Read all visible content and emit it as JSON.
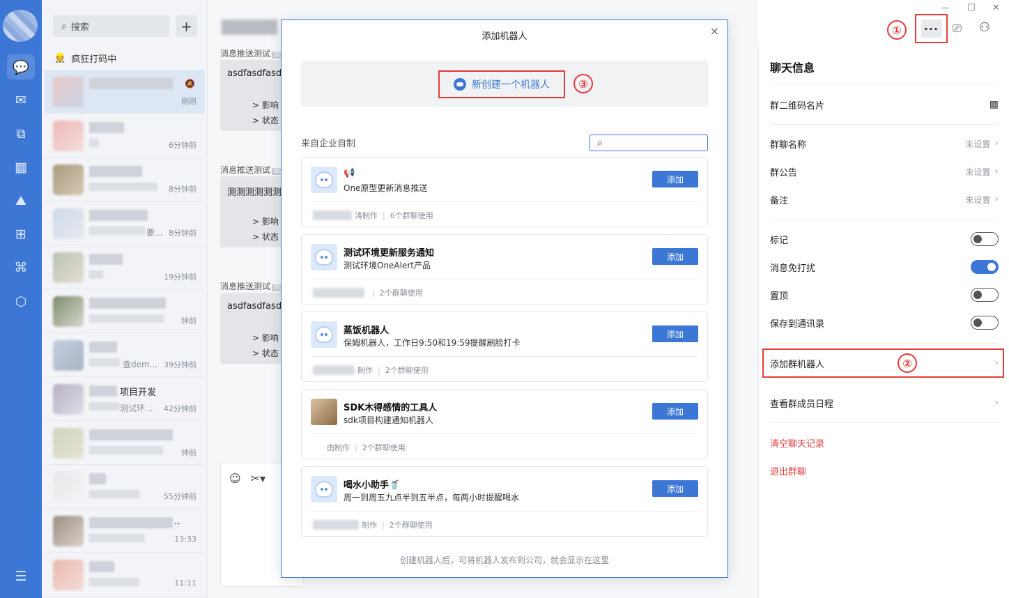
{
  "sidebar": {
    "search_placeholder": "搜索",
    "add_symbol": "+",
    "status_emoji": "👷",
    "status_text": "疯狂打码中",
    "conversations": [
      {
        "time": "刚刚"
      },
      {
        "time": "6分钟前"
      },
      {
        "time": "8分钟前"
      },
      {
        "sub": "要...",
        "time": "8分钟前"
      },
      {
        "time": "19分钟前"
      },
      {
        "time": "钟前"
      },
      {
        "sub": "查dem...",
        "time": "39分钟前"
      },
      {
        "title": "项目开发",
        "sub": "测试环...",
        "time": "42分钟前"
      },
      {
        "time": "钟前"
      },
      {
        "time": "55分钟前"
      },
      {
        "title": "..",
        "time": "13:33"
      },
      {
        "time": "11:11"
      }
    ]
  },
  "chat": {
    "messages": [
      {
        "label": "消息推送测试",
        "badge": "BO",
        "text": "asdfasdfasdg",
        "line1": "> 影响",
        "line2": "> 状态"
      },
      {
        "label": "消息推送测试",
        "badge": "BO",
        "text": "测测测测测测",
        "line1": "> 影响",
        "line2": "> 状态"
      },
      {
        "label": "消息推送测试",
        "badge": "BO",
        "text": "asdfasdfasdg",
        "line1": "> 影响",
        "line2": "> 状态"
      }
    ]
  },
  "modal": {
    "title": "添加机器人",
    "close": "×",
    "create_label": "新创建一个机器人",
    "marker3": "③",
    "section_label": "来自企业自制",
    "search_value": "",
    "add_label": "添加",
    "robots": [
      {
        "name": "📢",
        "desc": "One原型更新消息推送",
        "creator": "涛制作",
        "usage": "6个群聊使用"
      },
      {
        "name": "测试环境更新服务通知",
        "desc": "测试环境OneAlert产品",
        "creator": "",
        "usage": "2个群聊使用"
      },
      {
        "name": "蒸饭机器人",
        "desc": "保姆机器人，工作日9:50和19:59提醒刷脸打卡",
        "creator": "制作",
        "usage": "2个群聊使用"
      },
      {
        "name": "SDK木得感情的工具人",
        "desc": "sdk项目构建通知机器人",
        "creator": "由制作",
        "usage": "2个群聊使用"
      },
      {
        "name": "喝水小助手🥤",
        "desc": "周一到周五九点半到五半点，每两小时提醒喝水",
        "creator": "制作",
        "usage": "2个群聊使用"
      }
    ],
    "footnote": "创建机器人后，可将机器人发布到公司，就会显示在这里"
  },
  "header": {
    "marker1": "①",
    "more": "···",
    "video_icon": "video-call-icon",
    "adduser_icon": "add-user-icon"
  },
  "panel": {
    "title": "聊天信息",
    "qr": "群二维码名片",
    "name_label": "群聊名称",
    "notice_label": "群公告",
    "remark_label": "备注",
    "unset": "未设置",
    "mark_label": "标记",
    "mute_label": "消息免打扰",
    "pin_label": "置顶",
    "save_label": "保存到通讯录",
    "add_robot_label": "添加群机器人",
    "marker2": "②",
    "schedule_label": "查看群成员日程",
    "clear_label": "清空聊天记录",
    "exit_label": "退出群聊",
    "toggles": {
      "mark": false,
      "mute": true,
      "pin": false,
      "save": false
    }
  },
  "colors": {
    "accent": "#3c77d6",
    "highlight": "#e43b3b"
  }
}
